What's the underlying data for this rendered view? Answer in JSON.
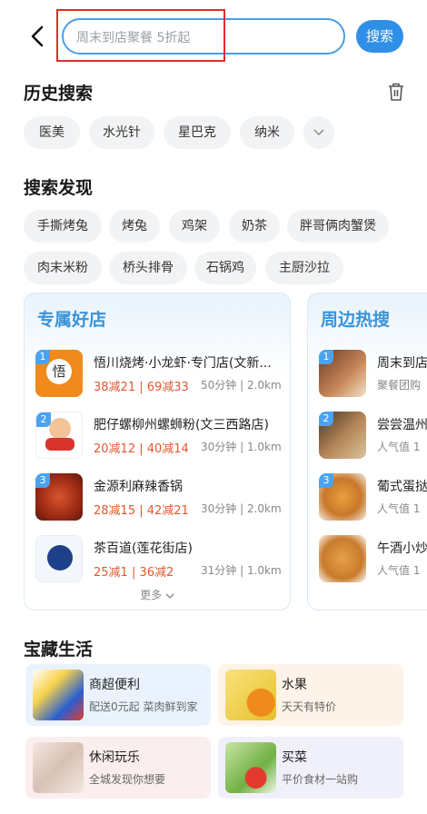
{
  "search": {
    "placeholder": "周末到店聚餐 5折起",
    "button": "搜索"
  },
  "history": {
    "title": "历史搜索",
    "items": [
      "医美",
      "水光针",
      "星巴克",
      "纳米"
    ]
  },
  "discover": {
    "title": "搜索发现",
    "items": [
      "手撕烤兔",
      "烤兔",
      "鸡架",
      "奶茶",
      "胖哥俩肉蟹煲",
      "肉末米粉",
      "桥头排骨",
      "石锅鸡",
      "主厨沙拉"
    ]
  },
  "exclusive": {
    "title": "专属好店",
    "shops": [
      {
        "rank": "1",
        "name": "悟川烧烤·小龙虾·专门店(文新...",
        "deal": "38减21 | 69减33",
        "meta": "50分钟 | 2.0km"
      },
      {
        "rank": "2",
        "name": "肥仔螺柳州螺蛳粉(文三西路店)",
        "deal": "20减12 | 40减14",
        "meta": "30分钟 | 1.0km"
      },
      {
        "rank": "3",
        "name": "金源利麻辣香锅",
        "deal": "28减15 | 42减21",
        "meta": "30分钟 | 2.0km"
      },
      {
        "rank": "",
        "name": "茶百道(莲花街店)",
        "deal": "25减1 | 36减2",
        "meta": "31分钟 | 1.0km"
      }
    ],
    "more": "更多"
  },
  "nearby": {
    "title": "周边热搜",
    "items": [
      {
        "rank": "1",
        "name": "周末到店",
        "sub": "聚餐团购"
      },
      {
        "rank": "2",
        "name": "尝尝温州",
        "sub": "人气值 1"
      },
      {
        "rank": "3",
        "name": "葡式蛋挞",
        "sub": "人气值 1"
      },
      {
        "rank": "",
        "name": "午酒小炒",
        "sub": "人气值 1"
      }
    ]
  },
  "treasure": {
    "title": "宝藏生活",
    "tiles": [
      {
        "title": "商超便利",
        "sub": "配送0元起 菜肉鲜到家"
      },
      {
        "title": "水果",
        "sub": "天天有特价"
      },
      {
        "title": "休闲玩乐",
        "sub": "全城发现你想要"
      },
      {
        "title": "买菜",
        "sub": "平价食材一站购"
      }
    ]
  },
  "colors": {
    "accent": "#2f8fe6",
    "deal": "#e4572e",
    "highlight": "#e52b2b"
  }
}
